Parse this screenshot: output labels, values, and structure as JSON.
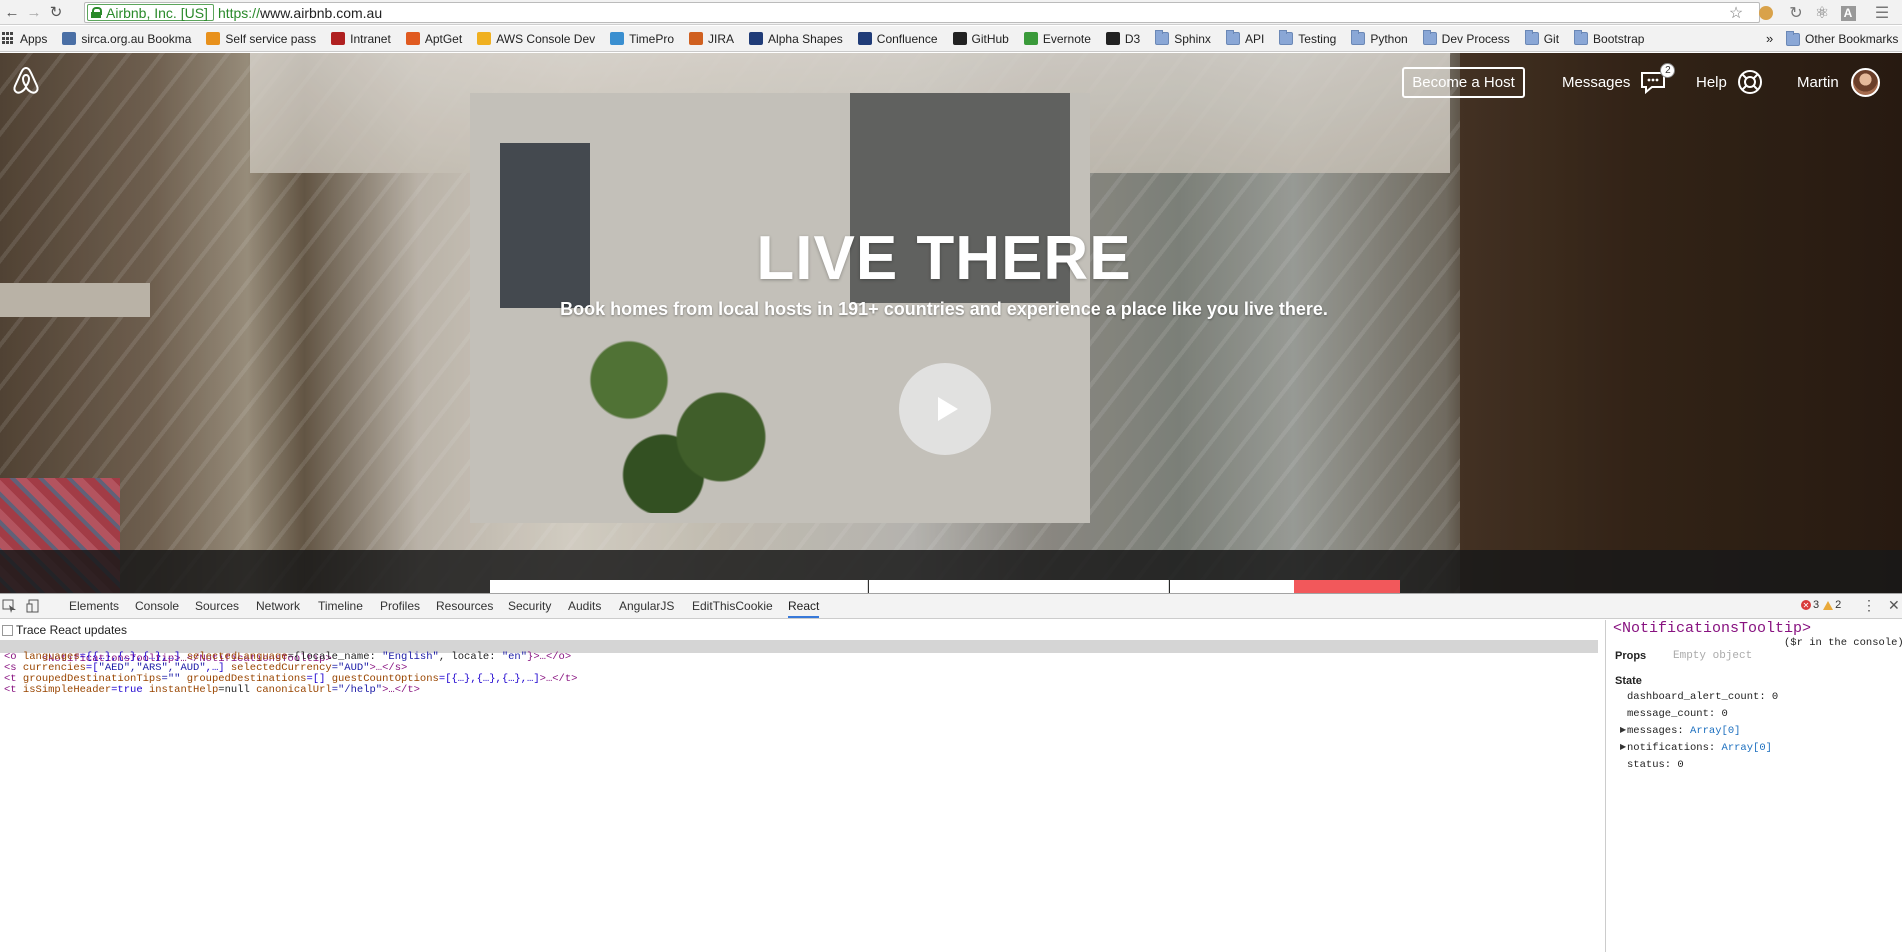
{
  "browser": {
    "ev_label": "Airbnb, Inc. [US]",
    "url_scheme": "https://",
    "url_rest": "www.airbnb.com.au"
  },
  "bookmarks": [
    {
      "label": "Apps",
      "icon": "apps-icon"
    },
    {
      "label": "sirca.org.au Bookma",
      "icon": "bookmark-page-icon",
      "color": "#4a6fa5"
    },
    {
      "label": "Self service pass",
      "icon": "self-service-icon",
      "color": "#e8911c"
    },
    {
      "label": "Intranet",
      "icon": "intranet-icon",
      "color": "#b02020"
    },
    {
      "label": "AptGet",
      "icon": "ubuntu-icon",
      "color": "#e05a20"
    },
    {
      "label": "AWS Console Dev",
      "icon": "aws-icon",
      "color": "#f0b020"
    },
    {
      "label": "TimePro",
      "icon": "timepro-icon",
      "color": "#3a8fd0"
    },
    {
      "label": "JIRA",
      "icon": "jira-icon",
      "color": "#d06020"
    },
    {
      "label": "Alpha Shapes",
      "icon": "confluence-x-icon",
      "color": "#203c78"
    },
    {
      "label": "Confluence",
      "icon": "confluence-x-icon",
      "color": "#203c78"
    },
    {
      "label": "GitHub",
      "icon": "github-icon",
      "color": "#222222"
    },
    {
      "label": "Evernote",
      "icon": "evernote-icon",
      "color": "#3a9a3a"
    },
    {
      "label": "D3",
      "icon": "github-icon",
      "color": "#222222"
    },
    {
      "label": "Sphinx",
      "icon": "folder-icon"
    },
    {
      "label": "API",
      "icon": "folder-icon"
    },
    {
      "label": "Testing",
      "icon": "folder-icon"
    },
    {
      "label": "Python",
      "icon": "folder-icon"
    },
    {
      "label": "Dev Process",
      "icon": "folder-icon"
    },
    {
      "label": "Git",
      "icon": "folder-icon"
    },
    {
      "label": "Bootstrap",
      "icon": "folder-icon"
    }
  ],
  "bookmarks_overflow": "»",
  "other_bookmarks": "Other Bookmarks",
  "airbnb": {
    "become_host": "Become a Host",
    "messages": "Messages",
    "messages_count": "2",
    "help": "Help",
    "user": "Martin",
    "hero_title": "LIVE THERE",
    "hero_subtitle": "Book homes from local hosts in 191+ countries and experience a place like you live there.",
    "brand_color": "#f2585b"
  },
  "devtools": {
    "tabs": [
      "Elements",
      "Console",
      "Sources",
      "Network",
      "Timeline",
      "Profiles",
      "Resources",
      "Security",
      "Audits",
      "AngularJS",
      "EditThisCookie",
      "React"
    ],
    "active_tab": "React",
    "error_count": "3",
    "warning_count": "2",
    "trace_label": "Trace React updates",
    "tree": {
      "selected": "<NotificationsTooltip>…</NotificationsTooltip>",
      "line1": {
        "open": "<o",
        "attr1": " languages",
        "val1": "={{…},{…},{…},…]",
        "attr2": " selectedLanguage",
        "val2a": "={locale_name: ",
        "str1": "\"English\"",
        "val2b": ", locale: ",
        "str2": "\"en\"",
        "close": "}>…</o>"
      },
      "line2": {
        "open": "<s",
        "attr1": " currencies",
        "val1": "=[",
        "str1": "\"AED\",\"ARS\",\"AUD\"",
        "val1b": ",…]",
        "attr2": " selectedCurrency",
        "str2": "=\"AUD\"",
        "close": ">…</s>"
      },
      "line3": {
        "open": "<t",
        "attr1": " groupedDestinationTips",
        "str1": "=\"\"",
        "attr2": " groupedDestinations",
        "val2": "=[]",
        "attr3": " guestCountOptions",
        "val3": "=[{…},{…},{…},…]",
        "close": ">…</t>"
      },
      "line4": {
        "open": "<t",
        "attr1": " isSimpleHeader",
        "val1": "=true",
        "attr2": " instantHelp",
        "val2": "=null",
        "attr3": " canonicalUrl",
        "str3": "=\"/help\"",
        "close": ">…</t>"
      }
    },
    "inspector": {
      "component": "<NotificationsTooltip>",
      "console_hint": "($r in the console)",
      "props_label": "Props",
      "props_empty": "Empty object",
      "state_label": "State",
      "state": {
        "dashboard_alert_count": "dashboard_alert_count: 0",
        "message_count": "message_count: 0",
        "messages_key": "messages: ",
        "messages_val": "Array[0]",
        "notifications_key": "notifications: ",
        "notifications_val": "Array[0]",
        "status": "status: 0"
      }
    }
  }
}
